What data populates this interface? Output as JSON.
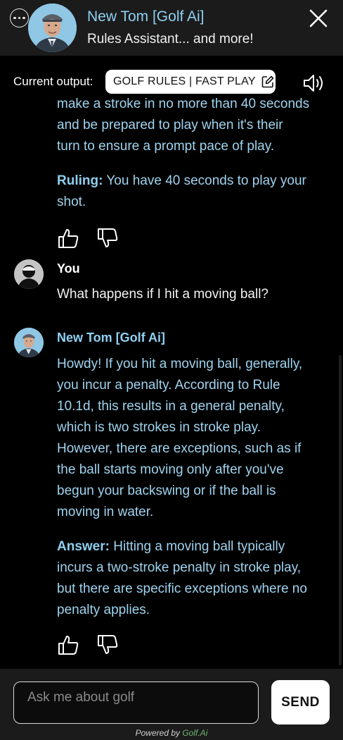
{
  "header": {
    "title": "New Tom [Golf Ai]",
    "subtitle": "Rules Assistant... and more!"
  },
  "output": {
    "label": "Current output:",
    "mode": "GOLF RULES | FAST PLAY"
  },
  "messages": [
    {
      "role": "assistant",
      "partial_lines": [
        "make a stroke in no more than 40 seconds",
        "and be prepared to play when it's their",
        "turn to ensure a prompt pace of play."
      ],
      "summary_label": "Ruling:",
      "summary_text": "You have 40 seconds to play your shot."
    },
    {
      "role": "user",
      "name": "You",
      "text": "What happens if I hit a moving ball?"
    },
    {
      "role": "assistant",
      "name": "New Tom [Golf Ai]",
      "body_lines": [
        "Howdy! If you hit a moving ball, generally,",
        "you incur a penalty. According to Rule",
        "10.1d, this results in a general penalty,",
        "which is two strokes in stroke play.",
        "However, there are exceptions, such as if",
        "the ball starts moving only after you've",
        "begun your backswing or if the ball is",
        "moving in water."
      ],
      "summary_label": "Answer:",
      "summary_lines": [
        "Hitting a moving ball typically",
        "incurs a two-stroke penalty in stroke play,",
        "but there are specific exceptions where no",
        "penalty applies."
      ]
    }
  ],
  "composer": {
    "placeholder": "Ask me about golf",
    "send_label": "SEND",
    "powered_by": "Powered by",
    "brand": "Golf.Ai"
  },
  "colors": {
    "accent": "#8fd0f2",
    "header_bg": "#1b1b1b",
    "brand_green": "#6db36b"
  }
}
